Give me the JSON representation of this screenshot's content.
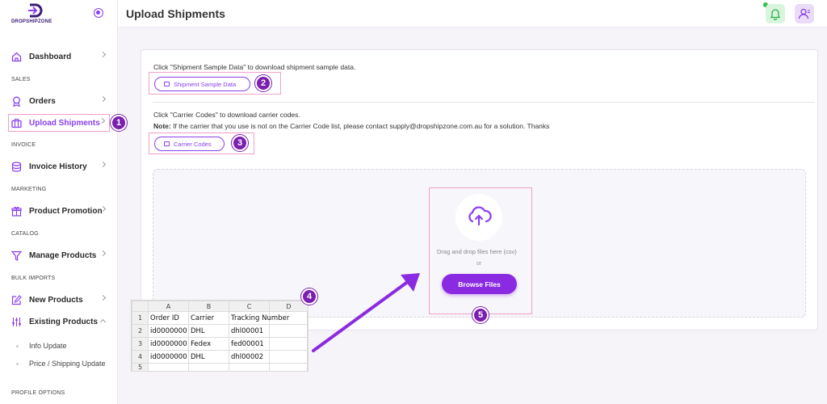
{
  "app": {
    "title": "Upload Shipments",
    "brand": "DROPSHIPZONE",
    "accent": "#8a2be2"
  },
  "sidebar": {
    "items": [
      {
        "label": "Dashboard",
        "icon": "home-icon"
      },
      {
        "section": "SALES"
      },
      {
        "label": "Orders",
        "icon": "award-icon"
      },
      {
        "label": "Upload Shipments",
        "icon": "briefcase-icon",
        "active": true
      },
      {
        "section": "INVOICE"
      },
      {
        "label": "Invoice History",
        "icon": "database-icon"
      },
      {
        "section": "MARKETING"
      },
      {
        "label": "Product Promotion",
        "icon": "gift-icon"
      },
      {
        "section": "CATALOG"
      },
      {
        "label": "Manage Products",
        "icon": "filter-icon"
      },
      {
        "section": "BULK IMPORTS"
      },
      {
        "label": "New Products",
        "icon": "edit-icon"
      },
      {
        "label": "Existing Products",
        "icon": "sliders-icon",
        "expanded": true
      },
      {
        "sub": "Info Update"
      },
      {
        "sub": "Price / Shipping Update"
      },
      {
        "section": "PROFILE OPTIONS"
      }
    ]
  },
  "main": {
    "sample_instruction": "Click \"Shipment Sample Data\" to download shipment sample data.",
    "sample_button": "Shipment Sample Data",
    "carrier_instruction": "Click \"Carrier Codes\" to download carrier codes.",
    "note_label": "Note:",
    "note_text": " If the carrier that you use is not on the Carrier Code list, please contact supply@dropshipzone.com.au for a solution. Thanks",
    "carrier_button": "Carrier Codes",
    "dropzone_text": "Drag and drop files here (csv)",
    "or_text": "or",
    "browse_button": "Browse Files"
  },
  "steps": [
    "1",
    "2",
    "3",
    "4",
    "5"
  ],
  "spreadsheet": {
    "columns": [
      "",
      "A",
      "B",
      "C",
      "D"
    ],
    "rows": [
      [
        "1",
        "Order ID",
        "Carrier",
        "Tracking Number",
        ""
      ],
      [
        "2",
        "id0000000",
        "DHL",
        "dhl00001",
        ""
      ],
      [
        "3",
        "id0000000",
        "Fedex",
        "fed00001",
        ""
      ],
      [
        "4",
        "id0000000",
        "DHL",
        "dhl00002",
        ""
      ],
      [
        "5",
        "",
        "",
        "",
        ""
      ]
    ]
  }
}
